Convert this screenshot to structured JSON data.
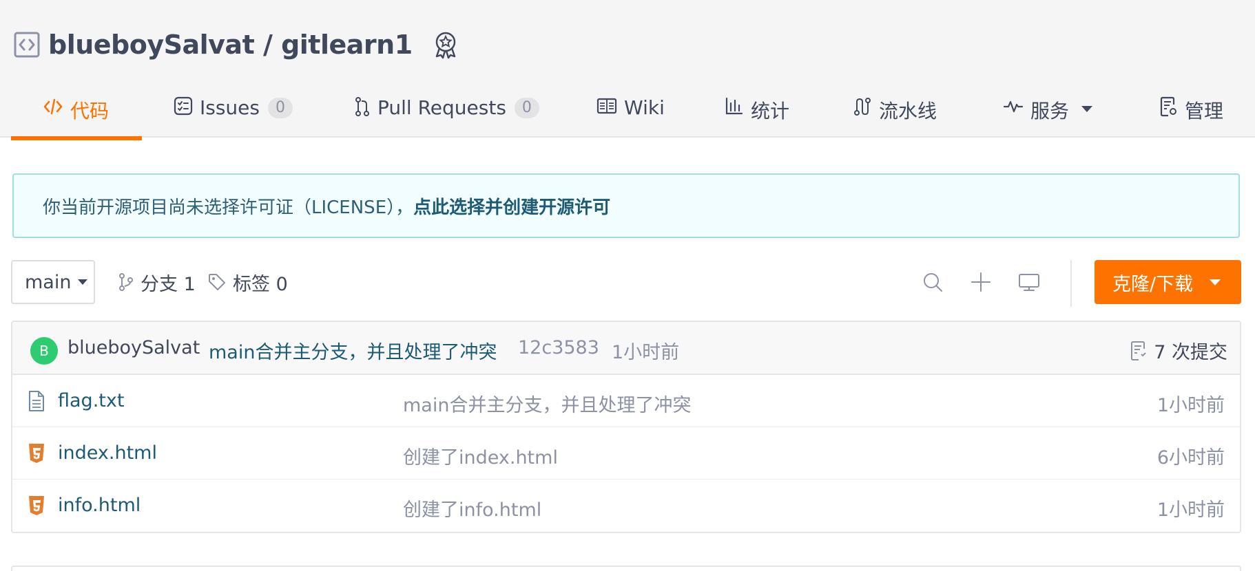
{
  "repo": {
    "title": "blueboySalvat / gitlearn1"
  },
  "tabs": [
    {
      "label": "代码",
      "icon": "code-icon",
      "active": true
    },
    {
      "label": "Issues",
      "icon": "issues-icon",
      "count": "0"
    },
    {
      "label": "Pull Requests",
      "icon": "pull-request-icon",
      "count": "0"
    },
    {
      "label": "Wiki",
      "icon": "book-icon"
    },
    {
      "label": "统计",
      "icon": "bar-chart-icon"
    },
    {
      "label": "流水线",
      "icon": "pipeline-icon"
    },
    {
      "label": "服务",
      "icon": "pulse-icon"
    },
    {
      "label": "管理",
      "icon": "settings-doc-icon"
    }
  ],
  "notice": {
    "text": "你当前开源项目尚未选择许可证（LICENSE），",
    "link": "点此选择并创建开源许可"
  },
  "toolbar": {
    "branch": "main",
    "branches": "分支 1",
    "tags": "标签 0",
    "clone_label": "克隆/下载"
  },
  "commit": {
    "avatar_letter": "B",
    "author": "blueboySalvat",
    "message": "main合并主分支，并且处理了冲突",
    "sha": "12c3583",
    "time": "1小时前",
    "count": "7 次提交"
  },
  "files": [
    {
      "name": "flag.txt",
      "type": "text",
      "message": "main合并主分支，并且处理了冲突",
      "time": "1小时前"
    },
    {
      "name": "index.html",
      "type": "html",
      "message": "创建了index.html",
      "time": "6小时前"
    },
    {
      "name": "info.html",
      "type": "html",
      "message": "创建了info.html",
      "time": "1小时前"
    }
  ],
  "colors": {
    "accent": "#fe7300",
    "link": "#1d5a73",
    "notice_bg": "#f2fdff",
    "avatar": "#2ecc71",
    "html_icon": "#e57e2c"
  }
}
